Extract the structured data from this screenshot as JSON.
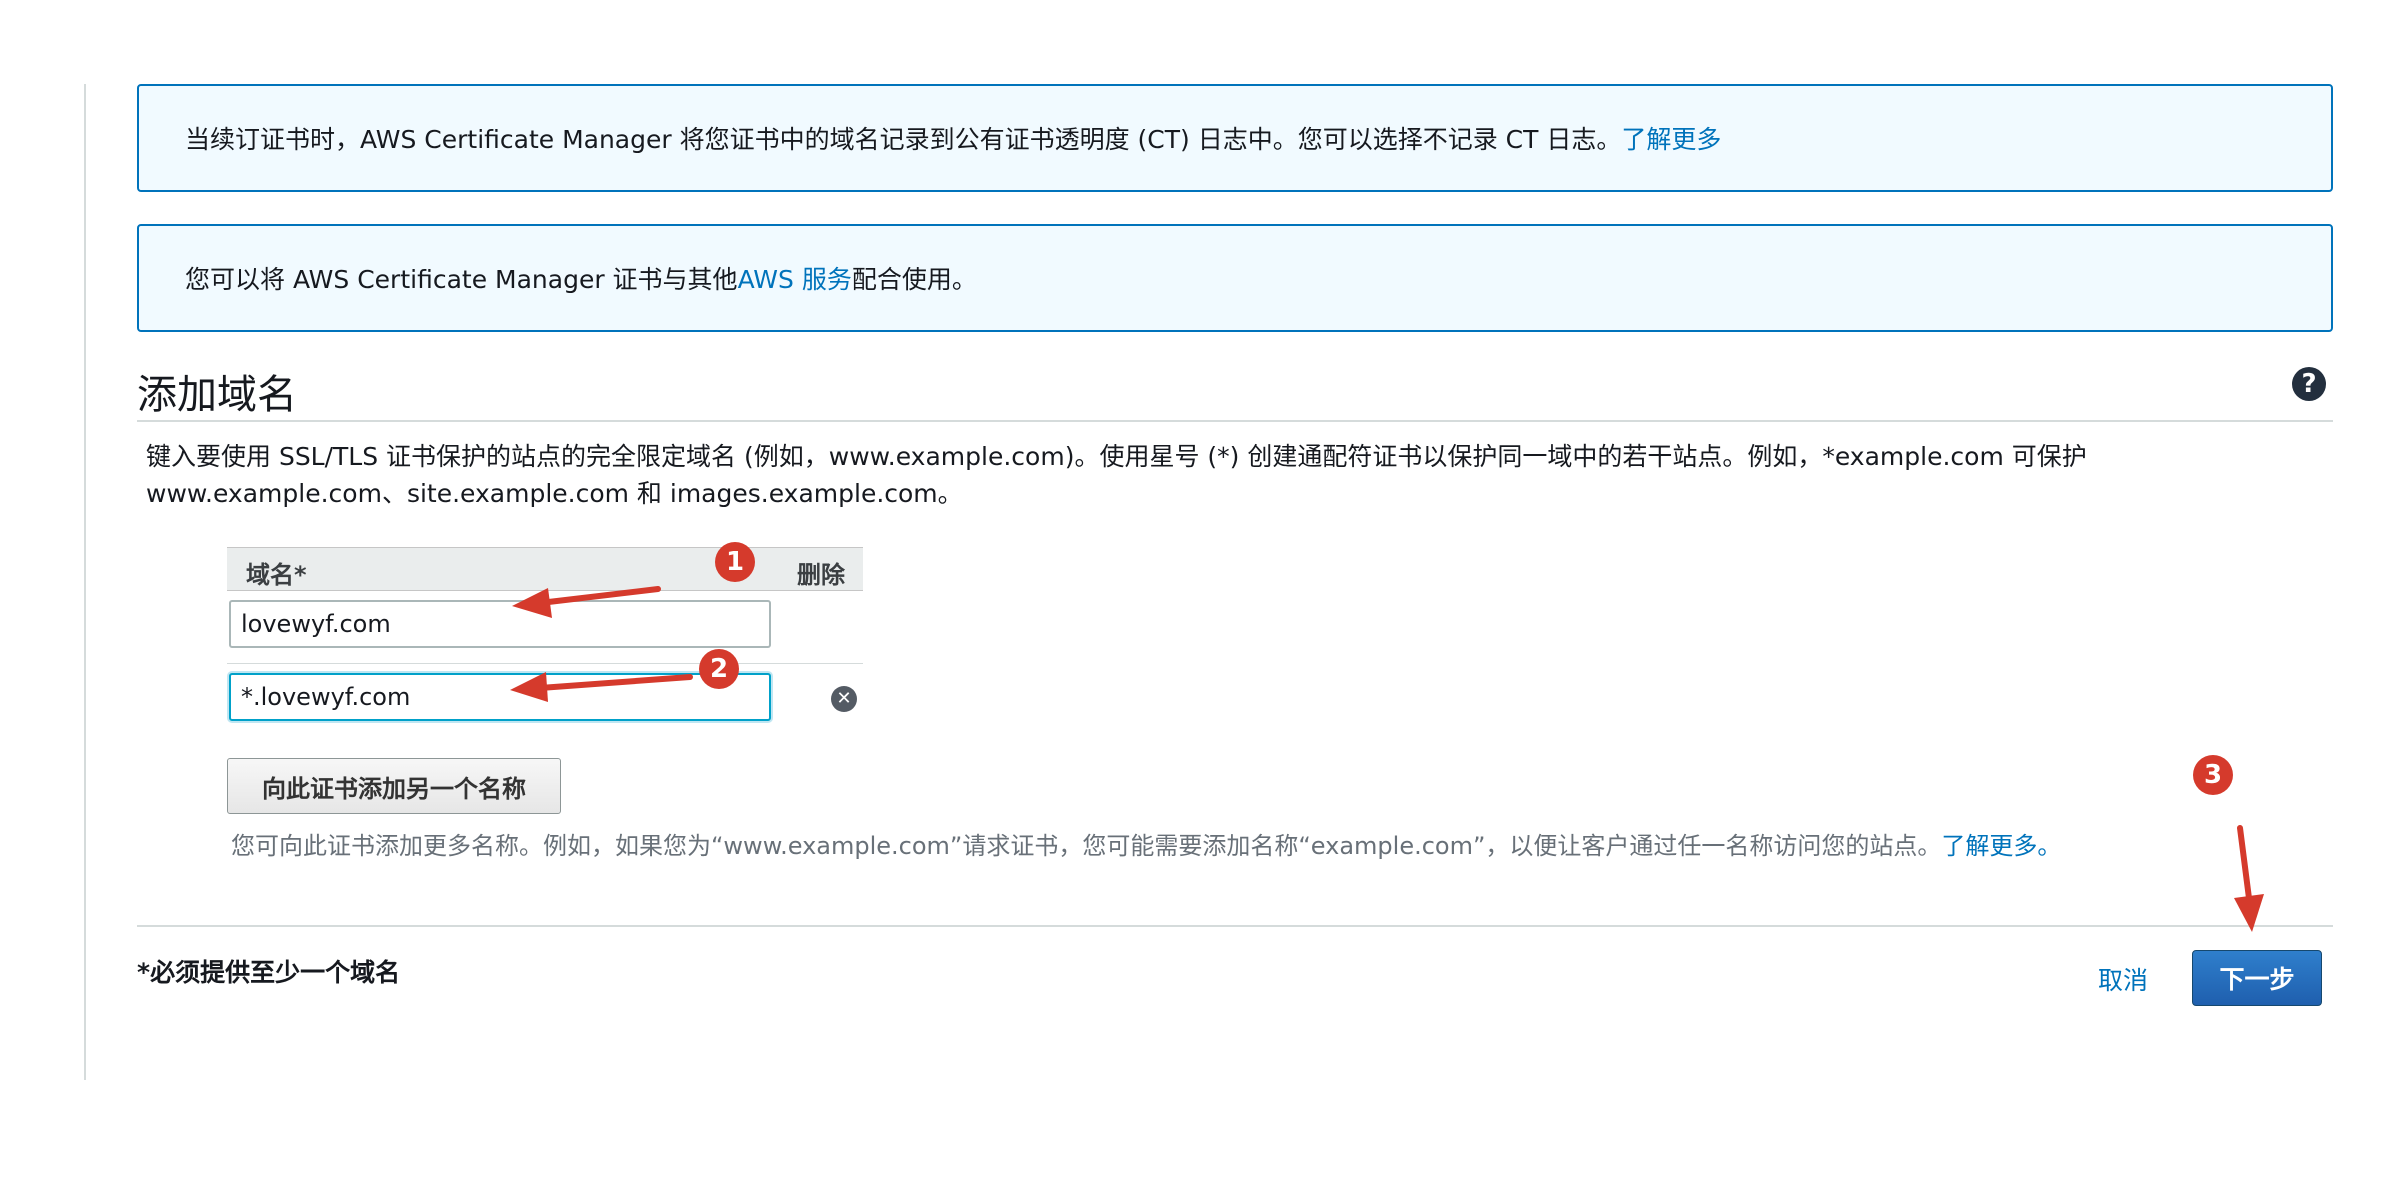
{
  "notices": {
    "ct_log_text": "当续订证书时，AWS Certificate Manager 将您证书中的域名记录到公有证书透明度 (CT) 日志中。您可以选择不记录 CT 日志。",
    "ct_log_link": "了解更多",
    "services_text_before": "您可以将 AWS Certificate Manager 证书与其他 ",
    "services_link": "AWS 服务",
    "services_text_after": "配合使用。"
  },
  "section": {
    "title": "添加域名",
    "help_icon": "question-circle-icon",
    "description": "键入要使用 SSL/TLS 证书保护的站点的完全限定域名 (例如，www.example.com)。使用星号 (*) 创建通配符证书以保护同一域中的若干站点。例如，*example.com 可保护 www.example.com、site.example.com 和 images.example.com。"
  },
  "domain_table": {
    "header_domain": "域名*",
    "header_delete": "删除",
    "rows": [
      {
        "value": "lovewyf.com"
      },
      {
        "value": "*.lovewyf.com"
      }
    ],
    "remove_icon": "remove-circle-icon"
  },
  "add_name": {
    "button_label": "向此证书添加另一个名称",
    "hint_text": "您可向此证书添加更多名称。例如，如果您为“www.example.com”请求证书，您可能需要添加名称“example.com”，以便让客户通过任一名称访问您的站点。",
    "hint_link": "了解更多。"
  },
  "footer": {
    "required_note": "*必须提供至少一个域名",
    "cancel_label": "取消",
    "next_label": "下一步"
  },
  "annotations": {
    "badge_1": "1",
    "badge_2": "2",
    "badge_3": "3",
    "color": "#d53a2c"
  },
  "colors": {
    "link": "#0073bb",
    "info_border": "#0073bb",
    "info_background": "#f1faff",
    "primary_button": "#1f5fae"
  }
}
